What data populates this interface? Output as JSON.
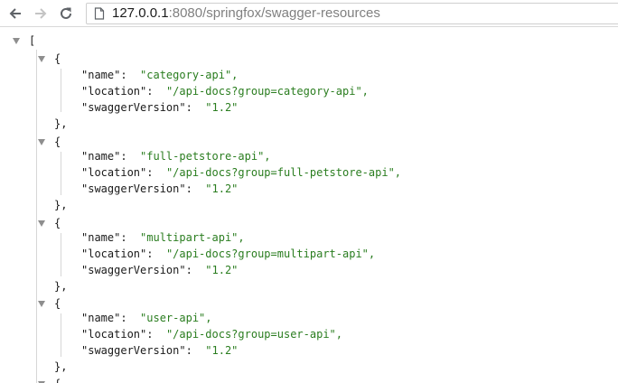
{
  "browser": {
    "back_icon": "arrow-left-icon",
    "forward_icon": "arrow-right-icon",
    "reload_icon": "reload-icon",
    "page_icon": "page-icon",
    "url_host": "127.0.0.1",
    "url_rest": ":8080/springfox/swagger-resources"
  },
  "json": {
    "open_bracket": "[",
    "open_brace": "{",
    "close_brace": "},",
    "key_name": "\"name\":",
    "key_location": "\"location\":",
    "key_swagger": "\"swaggerVersion\":",
    "items": [
      {
        "name": "\"category-api\",",
        "location": "\"/api-docs?group=category-api\",",
        "swaggerVersion": "\"1.2\""
      },
      {
        "name": "\"full-petstore-api\",",
        "location": "\"/api-docs?group=full-petstore-api\",",
        "swaggerVersion": "\"1.2\""
      },
      {
        "name": "\"multipart-api\",",
        "location": "\"/api-docs?group=multipart-api\",",
        "swaggerVersion": "\"1.2\""
      },
      {
        "name": "\"user-api\",",
        "location": "\"/api-docs?group=user-api\",",
        "swaggerVersion": "\"1.2\""
      }
    ]
  }
}
